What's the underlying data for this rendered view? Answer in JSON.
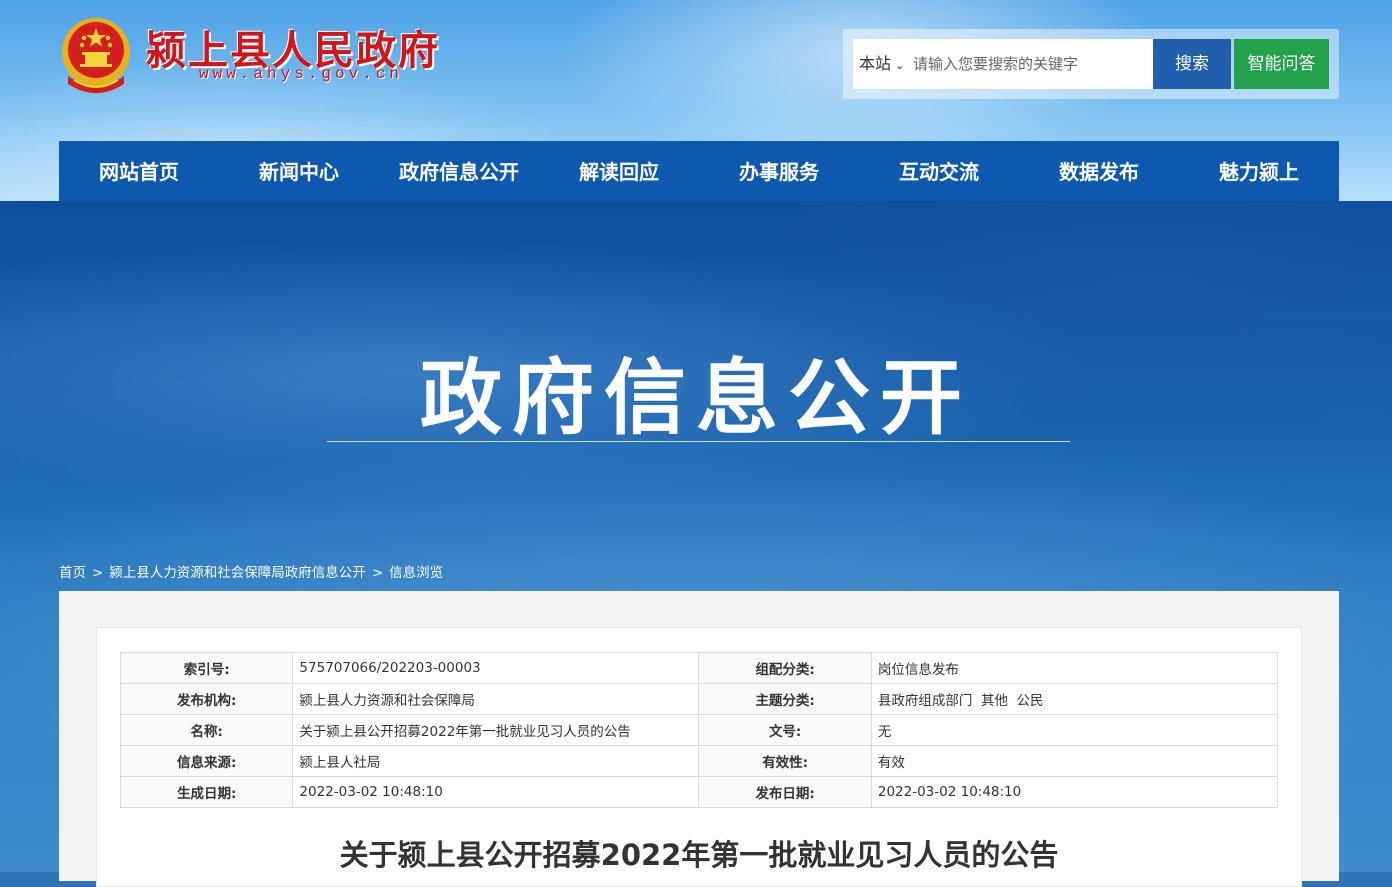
{
  "header": {
    "site_title": "颍上县人民政府",
    "site_url": "www.ahys.gov.cn",
    "search": {
      "scope": "本站",
      "placeholder": "请输入您要搜索的关键字",
      "search_button": "搜索",
      "ai_button": "智能问答"
    }
  },
  "nav": {
    "items": [
      "网站首页",
      "新闻中心",
      "政府信息公开",
      "解读回应",
      "办事服务",
      "互动交流",
      "数据发布",
      "魅力颍上"
    ]
  },
  "banner": {
    "title": "政府信息公开"
  },
  "breadcrumb": {
    "items": [
      "首页",
      "颍上县人力资源和社会保障局政府信息公开",
      "信息浏览"
    ],
    "separator": ">"
  },
  "meta": {
    "rows": [
      {
        "k1": "索引号:",
        "v1": "575707066/202203-00003",
        "k2": "组配分类:",
        "v2": "岗位信息发布"
      },
      {
        "k1": "发布机构:",
        "v1": "颍上县人力资源和社会保障局",
        "k2": "主题分类:",
        "v2": "县政府组成部门  其他  公民"
      },
      {
        "k1": "名称:",
        "v1": "关于颍上县公开招募2022年第一批就业见习人员的公告",
        "k2": "文号:",
        "v2": "无"
      },
      {
        "k1": "信息来源:",
        "v1": "颍上县人社局",
        "k2": "有效性:",
        "v2": "有效"
      },
      {
        "k1": "生成日期:",
        "v1": "2022-03-02 10:48:10",
        "k2": "发布日期:",
        "v2": "2022-03-02 10:48:10"
      }
    ]
  },
  "document": {
    "title": "关于颍上县公开招募2022年第一批就业见习人员的公告"
  },
  "colors": {
    "brand_red": "#d2141b",
    "nav_blue": "#0d59b0",
    "search_blue": "#1f5fab",
    "ai_green": "#22a34b"
  }
}
